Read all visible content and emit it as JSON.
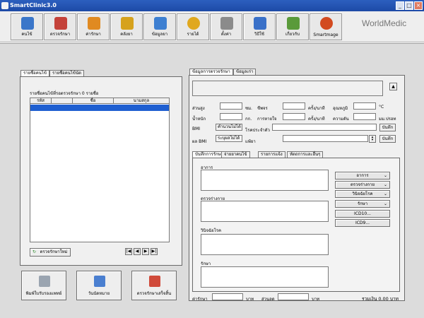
{
  "window": {
    "title": "SmartClinic3.0",
    "minimize": "_",
    "maximize": "□",
    "close": "×"
  },
  "toolbar": {
    "items": [
      {
        "label": "คนไข้",
        "color": "#3a76c9"
      },
      {
        "label": "ตรวจรักษา",
        "color": "#c4423a"
      },
      {
        "label": "ค่ารักษา",
        "color": "#e08a21"
      },
      {
        "label": "คลังยา",
        "color": "#d6a21d"
      },
      {
        "label": "ข้อมูลยา",
        "color": "#3d7fd1"
      },
      {
        "label": "รายได้",
        "color": "#e0a81f"
      },
      {
        "label": "ตั้งค่า",
        "color": "#8b8b8b"
      },
      {
        "label": "วิธีใช้",
        "color": "#3970c8"
      },
      {
        "label": "เกี่ยวกับ",
        "color": "#5a9a3a"
      },
      {
        "label": "Smartmage",
        "color": "#d24a1f"
      }
    ],
    "brand": "WorldMedic"
  },
  "left": {
    "tabs": [
      "รายชื่อคนไข้",
      "รายชื่อคนไข้นัด"
    ],
    "list_caption": "รายชื่อคนไข้ที่รอตรวจรักษา 0 รายชื่อ",
    "columns": [
      "รหัส",
      "",
      "ชื่อ",
      "นามสกุล"
    ],
    "new_exam_button": "ตรวจรักษาใหม่",
    "nav": [
      "|◀",
      "◀",
      "▶",
      "▶|"
    ],
    "big_buttons": [
      "พิมพ์ใบรับรองแพทย์",
      "วันนัดหมาย",
      "ตรวจรักษาเสร็จสิ้น"
    ]
  },
  "right": {
    "tabs": [
      "ข้อมูลการตรวจรักษา",
      "ข้อมูลเก่า"
    ],
    "collapse_icon": "▲",
    "vitals": {
      "height": "ส่วนสูง",
      "height_unit": "ซม.",
      "pulse": "ชีพจร",
      "pulse_unit": "ครั้ง/นาที",
      "temp": "อุณหภูมิ",
      "temp_unit": "°C",
      "weight": "น้ำหนัก",
      "weight_unit": "กก.",
      "resp": "การหายใจ",
      "resp_unit": "ครั้ง/นาที",
      "bp": "ความดัน",
      "bp_unit": "มม.ปรอท",
      "bmi": "BMI",
      "bmi_value": "คำนวนไม่ได้",
      "bmi_result": "ผล BMI",
      "bmi_result_value": "ระบุผลไม่ได้",
      "chronic": "โรคประจำตัว",
      "allergy": "แพ้ยา",
      "save": "บันทึก"
    },
    "sub_tabs": [
      "บันทึกการรักษา",
      "จ่ายยาคนไข้",
      "รายการแจ้ง",
      "หัตถการและอื่นๆ"
    ],
    "memo_labels": [
      "อาการ",
      "ตรวจร่างกาย",
      "วินิจฉัยโรค",
      "รักษา"
    ],
    "side_buttons": [
      "อาการ",
      "ตรวจร่างกาย",
      "วินิจฉัยโรค",
      "รักษา",
      "ICD10...",
      "ICD9..."
    ],
    "fee_label": "ค่ารักษา",
    "baht": "บาท",
    "discount_label": "ส่วนลด",
    "total": "รวมเงิน 0.00 บาท"
  }
}
